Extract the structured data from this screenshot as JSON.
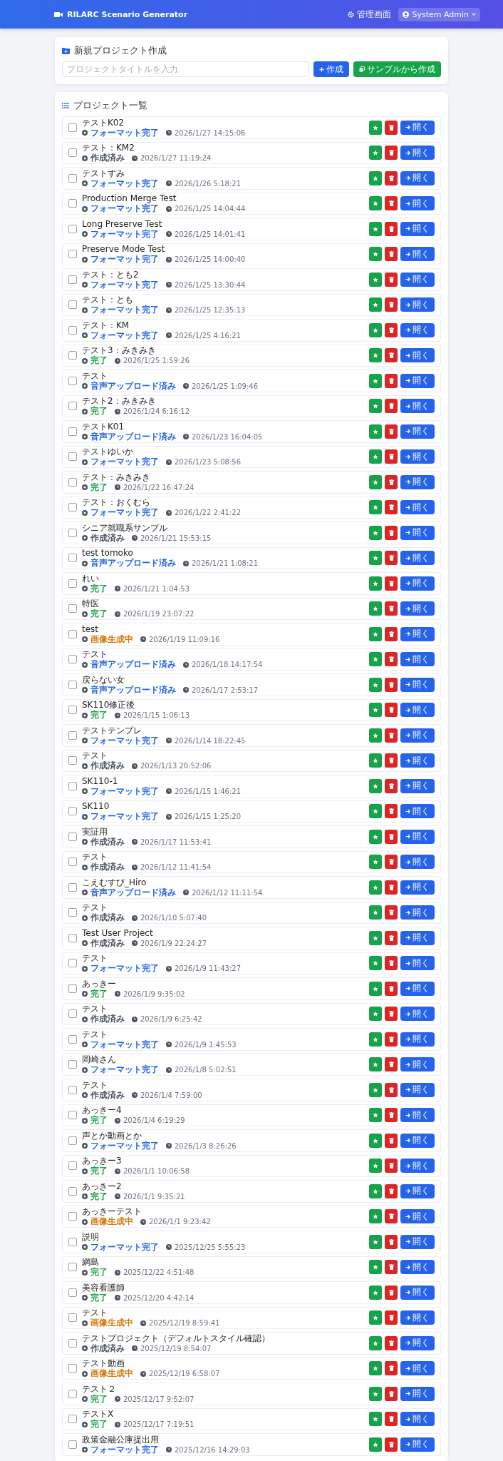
{
  "header": {
    "title": "RILARC Scenario Generator",
    "admin_link": "管理画面",
    "user": "System Admin"
  },
  "new_project": {
    "title": "新規プロジェクト作成",
    "input": {
      "placeholder": "プロジェクトタイトルを入力"
    },
    "create_button": "作成",
    "sample_button": "サンプルから作成"
  },
  "project_list": {
    "title": "プロジェクト一覧",
    "rows": [
      {
        "title": "テストK02",
        "status": {
          "label": "フォーマット完了",
          "color": "#2563eb"
        },
        "date": "2026/1/27 14:15:06",
        "checked": false,
        "open_button": "開く"
      },
      {
        "title": "テスト：KM2",
        "status": {
          "label": "作成済み",
          "color": "#4b5563"
        },
        "date": "2026/1/27 11:19:24",
        "checked": false,
        "open_button": "開く"
      },
      {
        "title": "テストすみ",
        "status": {
          "label": "フォーマット完了",
          "color": "#2563eb"
        },
        "date": "2026/1/26 5:18:21",
        "checked": false,
        "open_button": "開く"
      },
      {
        "title": "Production Merge Test",
        "status": {
          "label": "フォーマット完了",
          "color": "#2563eb"
        },
        "date": "2026/1/25 14:04:44",
        "checked": false,
        "open_button": "開く"
      },
      {
        "title": "Long Preserve Test",
        "status": {
          "label": "フォーマット完了",
          "color": "#2563eb"
        },
        "date": "2026/1/25 14:01:41",
        "checked": false,
        "open_button": "開く"
      },
      {
        "title": "Preserve Mode Test",
        "status": {
          "label": "フォーマット完了",
          "color": "#2563eb"
        },
        "date": "2026/1/25 14:00:40",
        "checked": false,
        "open_button": "開く"
      },
      {
        "title": "テスト：とも2",
        "status": {
          "label": "フォーマット完了",
          "color": "#2563eb"
        },
        "date": "2026/1/25 13:30:44",
        "checked": false,
        "open_button": "開く"
      },
      {
        "title": "テスト：とも",
        "status": {
          "label": "フォーマット完了",
          "color": "#2563eb"
        },
        "date": "2026/1/25 12:35:13",
        "checked": false,
        "open_button": "開く"
      },
      {
        "title": "テスト：KM",
        "status": {
          "label": "フォーマット完了",
          "color": "#2563eb"
        },
        "date": "2026/1/25 4:16:21",
        "checked": false,
        "open_button": "開く"
      },
      {
        "title": "テスト3：みきみき",
        "status": {
          "label": "完了",
          "color": "#16a34a"
        },
        "date": "2026/1/25 1:59:26",
        "checked": false,
        "open_button": "開く"
      },
      {
        "title": "テスト",
        "status": {
          "label": "音声アップロード済み",
          "color": "#2563eb"
        },
        "date": "2026/1/25 1:09:46",
        "checked": false,
        "open_button": "開く"
      },
      {
        "title": "テスト2：みきみき",
        "status": {
          "label": "完了",
          "color": "#16a34a"
        },
        "date": "2026/1/24 6:16:12",
        "checked": false,
        "open_button": "開く"
      },
      {
        "title": "テストK01",
        "status": {
          "label": "音声アップロード済み",
          "color": "#2563eb"
        },
        "date": "2026/1/23 16:04:05",
        "checked": false,
        "open_button": "開く"
      },
      {
        "title": "テストゆいか",
        "status": {
          "label": "フォーマット完了",
          "color": "#2563eb"
        },
        "date": "2026/1/23 5:08:56",
        "checked": false,
        "open_button": "開く"
      },
      {
        "title": "テスト：みきみき",
        "status": {
          "label": "完了",
          "color": "#16a34a"
        },
        "date": "2026/1/22 16:47:24",
        "checked": false,
        "open_button": "開く"
      },
      {
        "title": "テスト：おくむら",
        "status": {
          "label": "フォーマット完了",
          "color": "#2563eb"
        },
        "date": "2026/1/22 2:41:22",
        "checked": false,
        "open_button": "開く"
      },
      {
        "title": "シニア就職系サンプル",
        "status": {
          "label": "作成済み",
          "color": "#4b5563"
        },
        "date": "2026/1/21 15:53:15",
        "checked": false,
        "open_button": "開く"
      },
      {
        "title": "test tomoko",
        "status": {
          "label": "音声アップロード済み",
          "color": "#2563eb"
        },
        "date": "2026/1/21 1:08:21",
        "checked": false,
        "open_button": "開く"
      },
      {
        "title": "れい",
        "status": {
          "label": "完了",
          "color": "#16a34a"
        },
        "date": "2026/1/21 1:04:53",
        "checked": false,
        "open_button": "開く"
      },
      {
        "title": "特医",
        "status": {
          "label": "完了",
          "color": "#16a34a"
        },
        "date": "2026/1/19 23:07:22",
        "checked": false,
        "open_button": "開く"
      },
      {
        "title": "test",
        "status": {
          "label": "画像生成中",
          "color": "#d97706"
        },
        "date": "2026/1/19 11:09:16",
        "checked": false,
        "open_button": "開く"
      },
      {
        "title": "テスト",
        "status": {
          "label": "音声アップロード済み",
          "color": "#2563eb"
        },
        "date": "2026/1/18 14:17:54",
        "checked": false,
        "open_button": "開く"
      },
      {
        "title": "戻らない女",
        "status": {
          "label": "音声アップロード済み",
          "color": "#2563eb"
        },
        "date": "2026/1/17 2:53:17",
        "checked": false,
        "open_button": "開く"
      },
      {
        "title": "SK110修正後",
        "status": {
          "label": "完了",
          "color": "#16a34a"
        },
        "date": "2026/1/15 1:06:13",
        "checked": false,
        "open_button": "開く"
      },
      {
        "title": "テストテンプレ",
        "status": {
          "label": "フォーマット完了",
          "color": "#2563eb"
        },
        "date": "2026/1/14 18:22:45",
        "checked": false,
        "open_button": "開く"
      },
      {
        "title": "テスト",
        "status": {
          "label": "作成済み",
          "color": "#4b5563"
        },
        "date": "2026/1/13 20:52:06",
        "checked": false,
        "open_button": "開く"
      },
      {
        "title": "SK110-1",
        "status": {
          "label": "フォーマット完了",
          "color": "#2563eb"
        },
        "date": "2026/1/15 1:46:21",
        "checked": false,
        "open_button": "開く"
      },
      {
        "title": "SK110",
        "status": {
          "label": "フォーマット完了",
          "color": "#2563eb"
        },
        "date": "2026/1/15 1:25:20",
        "checked": false,
        "open_button": "開く"
      },
      {
        "title": "実証用",
        "status": {
          "label": "作成済み",
          "color": "#4b5563"
        },
        "date": "2026/1/17 11:53:41",
        "checked": false,
        "open_button": "開く"
      },
      {
        "title": "テスト",
        "status": {
          "label": "作成済み",
          "color": "#4b5563"
        },
        "date": "2026/1/12 11:41:54",
        "checked": false,
        "open_button": "開く"
      },
      {
        "title": "こえむすび_Hiro",
        "status": {
          "label": "音声アップロード済み",
          "color": "#2563eb"
        },
        "date": "2026/1/12 11:11:54",
        "checked": false,
        "open_button": "開く"
      },
      {
        "title": "テスト",
        "status": {
          "label": "作成済み",
          "color": "#4b5563"
        },
        "date": "2026/1/10 5:07:40",
        "checked": false,
        "open_button": "開く"
      },
      {
        "title": "Test User Project",
        "status": {
          "label": "作成済み",
          "color": "#4b5563"
        },
        "date": "2026/1/9 22:24:27",
        "checked": false,
        "open_button": "開く"
      },
      {
        "title": "テスト",
        "status": {
          "label": "フォーマット完了",
          "color": "#2563eb"
        },
        "date": "2026/1/9 11:43:27",
        "checked": false,
        "open_button": "開く"
      },
      {
        "title": "あっきー",
        "status": {
          "label": "完了",
          "color": "#16a34a"
        },
        "date": "2026/1/9 9:35:02",
        "checked": false,
        "open_button": "開く"
      },
      {
        "title": "テスト",
        "status": {
          "label": "作成済み",
          "color": "#4b5563"
        },
        "date": "2026/1/9 6:25:42",
        "checked": false,
        "open_button": "開く"
      },
      {
        "title": "テスト",
        "status": {
          "label": "フォーマット完了",
          "color": "#2563eb"
        },
        "date": "2026/1/9 1:45:53",
        "checked": false,
        "open_button": "開く"
      },
      {
        "title": "岡崎さん",
        "status": {
          "label": "フォーマット完了",
          "color": "#2563eb"
        },
        "date": "2026/1/8 5:02:51",
        "checked": false,
        "open_button": "開く"
      },
      {
        "title": "テスト",
        "status": {
          "label": "作成済み",
          "color": "#4b5563"
        },
        "date": "2026/1/4 7:59:00",
        "checked": false,
        "open_button": "開く"
      },
      {
        "title": "あっきー4",
        "status": {
          "label": "完了",
          "color": "#16a34a"
        },
        "date": "2026/1/4 6:19:29",
        "checked": false,
        "open_button": "開く"
      },
      {
        "title": "声とか動画とか",
        "status": {
          "label": "フォーマット完了",
          "color": "#2563eb"
        },
        "date": "2026/1/3 8:26:26",
        "checked": false,
        "open_button": "開く"
      },
      {
        "title": "あっきー3",
        "status": {
          "label": "完了",
          "color": "#16a34a"
        },
        "date": "2026/1/1 10:06:58",
        "checked": false,
        "open_button": "開く"
      },
      {
        "title": "あっきー2",
        "status": {
          "label": "完了",
          "color": "#16a34a"
        },
        "date": "2026/1/1 9:35:21",
        "checked": false,
        "open_button": "開く"
      },
      {
        "title": "あっきーテスト",
        "status": {
          "label": "画像生成中",
          "color": "#d97706"
        },
        "date": "2026/1/1 9:23:42",
        "checked": false,
        "open_button": "開く"
      },
      {
        "title": "説明",
        "status": {
          "label": "フォーマット完了",
          "color": "#2563eb"
        },
        "date": "2025/12/25 5:55:23",
        "checked": false,
        "open_button": "開く"
      },
      {
        "title": "網島",
        "status": {
          "label": "完了",
          "color": "#16a34a"
        },
        "date": "2025/12/22 4:51:48",
        "checked": false,
        "open_button": "開く"
      },
      {
        "title": "美容看護師",
        "status": {
          "label": "完了",
          "color": "#16a34a"
        },
        "date": "2025/12/20 4:42:14",
        "checked": false,
        "open_button": "開く"
      },
      {
        "title": "テスト",
        "status": {
          "label": "画像生成中",
          "color": "#d97706"
        },
        "date": "2025/12/19 8:59:41",
        "checked": false,
        "open_button": "開く"
      },
      {
        "title": "テストプロジェクト（デフォルトスタイル確認）",
        "status": {
          "label": "作成済み",
          "color": "#4b5563"
        },
        "date": "2025/12/19 8:54:07",
        "checked": false,
        "open_button": "開く"
      },
      {
        "title": "テスト動画",
        "status": {
          "label": "画像生成中",
          "color": "#d97706"
        },
        "date": "2025/12/19 6:58:07",
        "checked": false,
        "open_button": "開く"
      },
      {
        "title": "テスト２",
        "status": {
          "label": "完了",
          "color": "#16a34a"
        },
        "date": "2025/12/17 9:52:07",
        "checked": false,
        "open_button": "開く"
      },
      {
        "title": "テストX",
        "status": {
          "label": "完了",
          "color": "#16a34a"
        },
        "date": "2025/12/17 7:19:51",
        "checked": false,
        "open_button": "開く"
      },
      {
        "title": "政策金融公庫提出用",
        "status": {
          "label": "フォーマット完了",
          "color": "#2563eb"
        },
        "date": "2025/12/16 14:29:03",
        "checked": false,
        "open_button": "開く"
      }
    ]
  }
}
